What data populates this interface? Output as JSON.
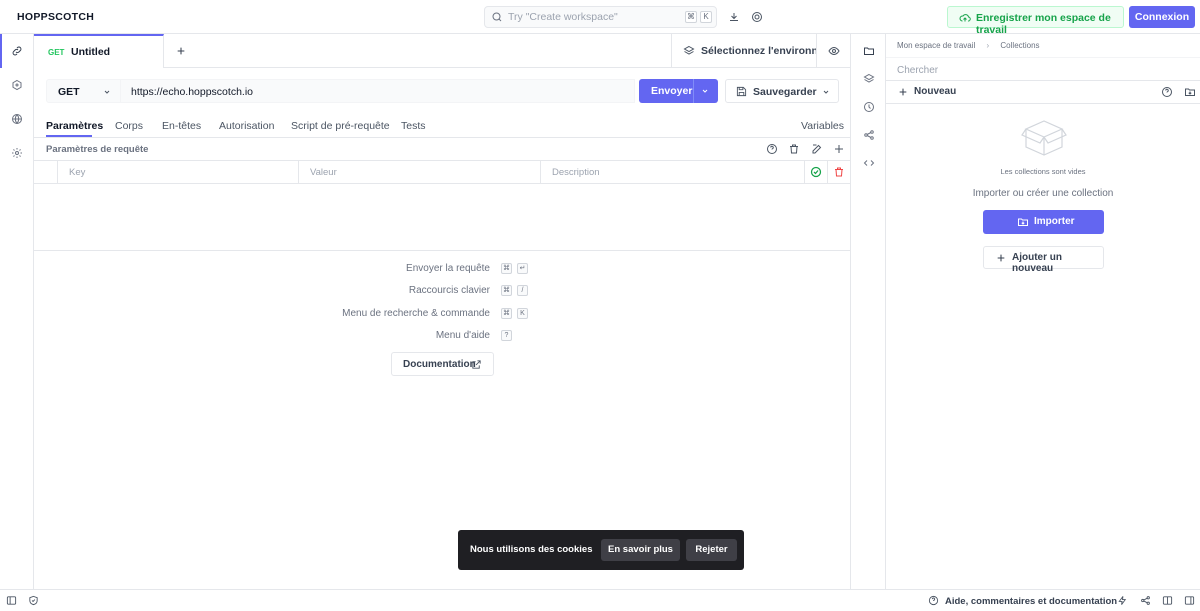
{
  "app": {
    "name": "HOPPSCOTCH"
  },
  "search": {
    "placeholder": "Try \"Create workspace\"",
    "kbd": [
      "⌘",
      "K"
    ]
  },
  "header": {
    "save_workspace": "Enregistrer mon espace de travail",
    "login": "Connexion"
  },
  "request_tab": {
    "method": "GET",
    "name": "Untitled"
  },
  "environment": {
    "label": "Sélectionnez l'environnement"
  },
  "request": {
    "method": "GET",
    "url": "https://echo.hoppscotch.io",
    "send": "Envoyer",
    "save": "Sauvegarder"
  },
  "subtabs": {
    "items": [
      "Paramètres",
      "Corps",
      "En-têtes",
      "Autorisation",
      "Script de pré-requête",
      "Tests"
    ],
    "variables": "Variables"
  },
  "params": {
    "title": "Paramètres de requête",
    "columns": {
      "key": "Key",
      "value": "Valeur",
      "description": "Description"
    }
  },
  "shortcuts": [
    {
      "label": "Envoyer la requête",
      "keys": [
        "⌘",
        "↵"
      ]
    },
    {
      "label": "Raccourcis clavier",
      "keys": [
        "⌘",
        "/"
      ]
    },
    {
      "label": "Menu de recherche & commande",
      "keys": [
        "⌘",
        "K"
      ]
    },
    {
      "label": "Menu d'aide",
      "keys": [
        "?"
      ]
    }
  ],
  "documentation": "Documentation",
  "collections": {
    "breadcrumb": [
      "Mon espace de travail",
      "Collections"
    ],
    "search_placeholder": "Chercher",
    "new": "Nouveau",
    "empty": "Les collections sont vides",
    "import_or_create": "Importer ou créer une collection",
    "import": "Importer",
    "add_new": "Ajouter un nouveau"
  },
  "cookie": {
    "text": "Nous utilisons des cookies",
    "learn_more": "En savoir plus",
    "reject": "Rejeter"
  },
  "status": {
    "help": "Aide, commentaires et documentation"
  },
  "colors": {
    "accent": "#6366f1",
    "success": "#16a34a",
    "danger": "#ef4444"
  }
}
